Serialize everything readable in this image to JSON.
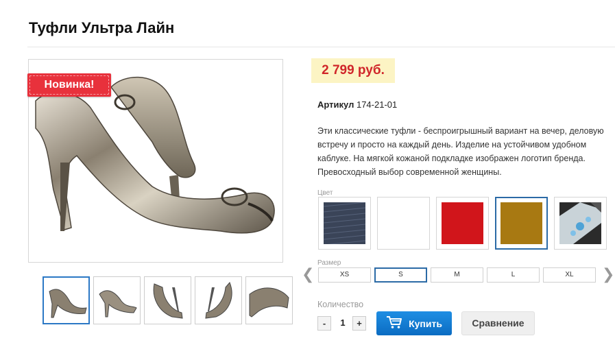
{
  "product": {
    "title": "Туфли Ультра Лайн",
    "badge": "Новинка!",
    "price": "2 799 руб.",
    "article_label": "Артикул",
    "article_value": "174-21-01",
    "description": "Эти классические туфли - беспроигрышный вариант на вечер, деловую встречу и просто на каждый день. Изделие на устойчивом удобном каблуке. На мягкой кожаной подкладке изображен логотип бренда. Превосходный выбор современной женщины."
  },
  "colors": {
    "label": "Цвет",
    "options": [
      {
        "name": "denim",
        "hex": "#3a4458"
      },
      {
        "name": "white",
        "hex": "#ffffff"
      },
      {
        "name": "red",
        "hex": "#d1151b"
      },
      {
        "name": "mustard",
        "hex": "#a87912",
        "selected": true
      },
      {
        "name": "floral",
        "hex": "#2b2b2b"
      }
    ]
  },
  "sizes": {
    "label": "Размер",
    "options": [
      "XS",
      "S",
      "M",
      "L",
      "XL"
    ],
    "selected": "S"
  },
  "quantity": {
    "label": "Количество",
    "minus": "-",
    "value": "1",
    "plus": "+"
  },
  "actions": {
    "buy_label": "Купить",
    "compare_label": "Сравнение"
  },
  "icons": {
    "cart": "cart-icon",
    "prev": "chevron-left-icon",
    "next": "chevron-right-icon"
  },
  "theme": {
    "accent": "#1a82d8",
    "badge": "#e8313c",
    "price": "#d0262a",
    "price_bg": "#fcf4c4",
    "selected_border": "#2b6aa6"
  }
}
